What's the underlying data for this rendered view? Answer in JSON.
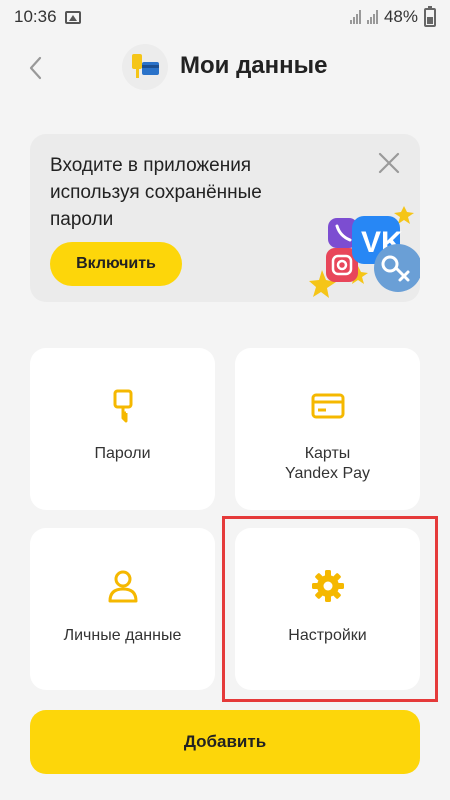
{
  "status_bar": {
    "time": "10:36",
    "battery": "48%"
  },
  "header": {
    "title": "Мои данные"
  },
  "banner": {
    "text": "Входите в приложения используя сохранённые пароли",
    "enable_label": "Включить"
  },
  "tiles": [
    {
      "label": "Пароли",
      "icon": "key-icon"
    },
    {
      "label": "Карты\nYandex Pay",
      "icon": "card-icon"
    },
    {
      "label": "Личные данные",
      "icon": "person-icon"
    },
    {
      "label": "Настройки",
      "icon": "gear-icon"
    }
  ],
  "add_label": "Добавить",
  "colors": {
    "accent": "#fdd60a",
    "icon": "#f5b800",
    "highlight": "#e53a3a",
    "background": "#f4f4f4"
  }
}
